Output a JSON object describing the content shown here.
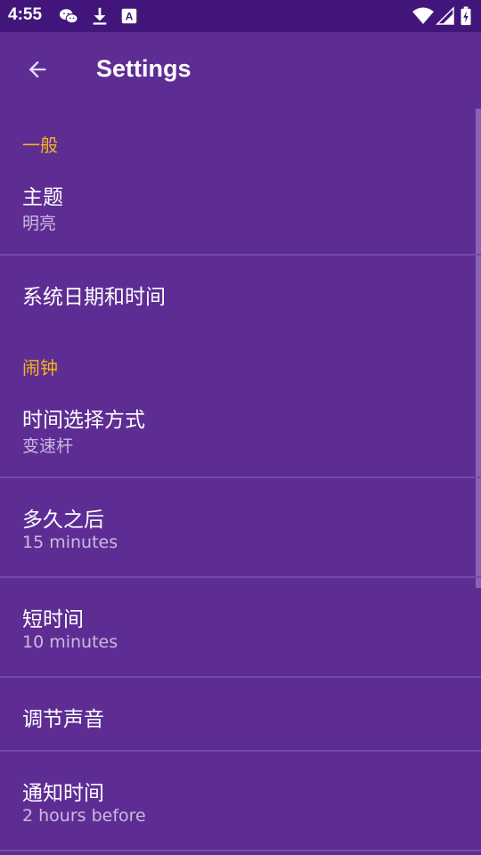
{
  "status_bar": {
    "time": "4:55",
    "icons": [
      "wechat-icon",
      "download-icon",
      "a-icon",
      "wifi-icon",
      "signal-icon",
      "battery-icon"
    ]
  },
  "app_bar": {
    "title": "Settings",
    "back_icon": "arrow-left-icon"
  },
  "colors": {
    "background": "#5e2d94",
    "status_bar": "#42157a",
    "section_header": "#f6b31b",
    "summary": "#cbb9e0",
    "divider": "#7549a6"
  },
  "sections": {
    "general": {
      "header": "一般",
      "theme": {
        "title": "主题",
        "summary": "明亮"
      },
      "system_datetime": {
        "title": "系统日期和时间"
      }
    },
    "alarm": {
      "header": "闹钟",
      "time_picker": {
        "title": "时间选择方式",
        "summary": "变速杆"
      },
      "how_long_after": {
        "title": "多久之后",
        "summary": "15 minutes"
      },
      "short_time": {
        "title": "短时间",
        "summary": "10 minutes"
      },
      "adjust_sound": {
        "title": "调节声音"
      },
      "notify_time": {
        "title": "通知时间",
        "summary": "2 hours before"
      }
    }
  }
}
